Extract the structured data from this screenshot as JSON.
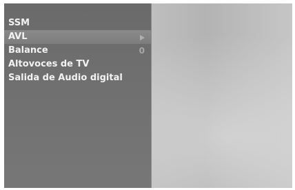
{
  "menu": {
    "items": [
      {
        "label": "SSM"
      },
      {
        "label": "AVL",
        "has_submenu": true,
        "selected": true
      },
      {
        "label": "Balance",
        "value": "0"
      },
      {
        "label": "Altovoces de TV"
      },
      {
        "label": "Salida de Audio digital"
      }
    ]
  },
  "colors": {
    "panel": "#6f6f6f",
    "highlight": "#838383",
    "text": "#f2f2f2",
    "value_text": "#a8a8a8"
  }
}
